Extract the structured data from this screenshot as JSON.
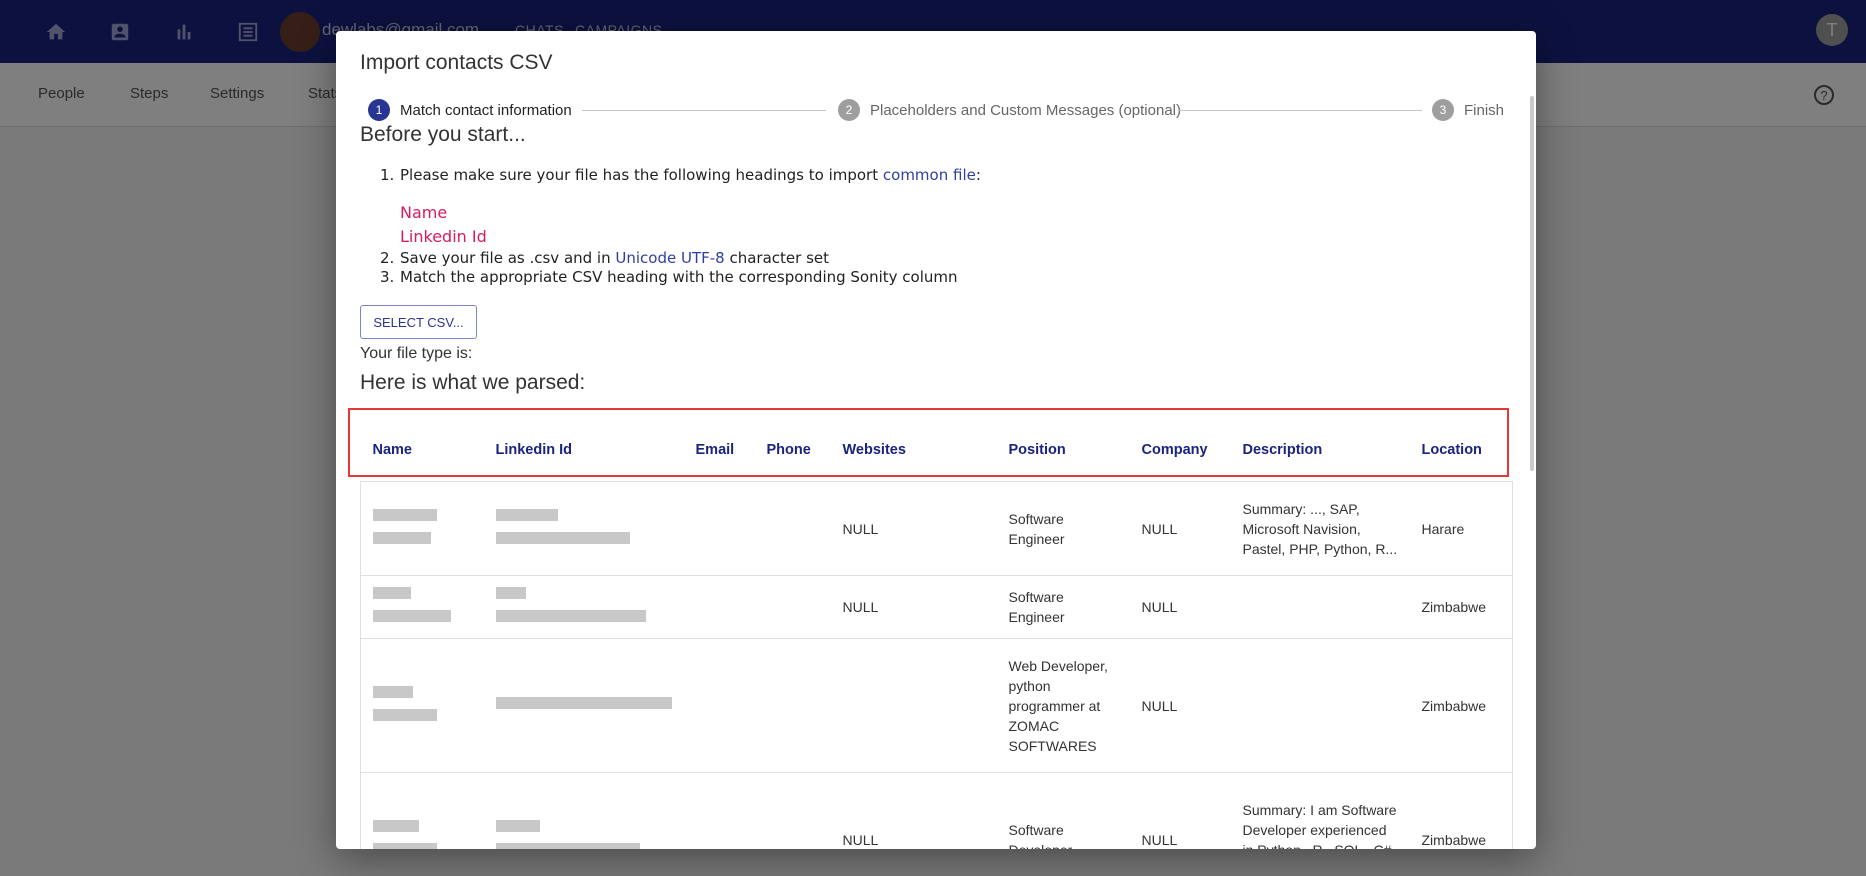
{
  "topbar": {
    "email": "dewlabs@gmail.com",
    "links": [
      "CHATS",
      "CAMPAIGNS"
    ],
    "user_initial": "T"
  },
  "subnav": {
    "tabs": [
      "People",
      "Steps",
      "Settings",
      "Stats"
    ],
    "help": "?"
  },
  "modal": {
    "title": "Import contacts CSV",
    "steps": [
      {
        "num": "1",
        "label": "Match contact information"
      },
      {
        "num": "2",
        "label": "Placeholders and Custom Messages (optional)"
      },
      {
        "num": "3",
        "label": "Finish"
      }
    ],
    "before_heading": "Before you start...",
    "instructions": {
      "n1": "1.",
      "n2": "2.",
      "n3": "3.",
      "item1_a": "Please make sure your file has the following headings to import ",
      "item1_link": "common file",
      "item1_b": ":",
      "required_name": "Name",
      "required_linkedin": "Linkedin Id",
      "item2_a": "Save your file as .csv and in ",
      "item2_link": "Unicode UTF-8",
      "item2_b": " character set",
      "item3": "Match the appropriate CSV heading with the corresponding Sonity column"
    },
    "select_button": "SELECT CSV...",
    "file_type_label": "Your file type is:",
    "parsed_heading": "Here is what we parsed:",
    "table": {
      "headers": [
        "Name",
        "Linkedin Id",
        "Email",
        "Phone",
        "Websites",
        "Position",
        "Company",
        "Description",
        "Location"
      ],
      "rows": [
        {
          "websites": "NULL",
          "position": "Software Engineer",
          "company": "NULL",
          "description": "Summary: ..., SAP, Microsoft Navision, Pastel, PHP, Python, R...",
          "location": "Harare"
        },
        {
          "websites": "NULL",
          "position": "Software Engineer",
          "company": "NULL",
          "description": "",
          "location": "Zimbabwe"
        },
        {
          "websites": "",
          "position": "Web Developer, python programmer at ZOMAC SOFTWARES",
          "company": "NULL",
          "description": "",
          "location": "Zimbabwe"
        },
        {
          "websites": "NULL",
          "position": "Software Developer",
          "company": "NULL",
          "description": "Summary: I am Software Developer experienced in Python , R , SQL , C# and",
          "location": "Zimbabwe"
        }
      ]
    }
  },
  "colors": {
    "primary": "#1a237e",
    "step_active": "#283593",
    "step_inactive": "#9e9e9e",
    "required_field": "#d81b60",
    "highlight_border": "#e53935"
  }
}
